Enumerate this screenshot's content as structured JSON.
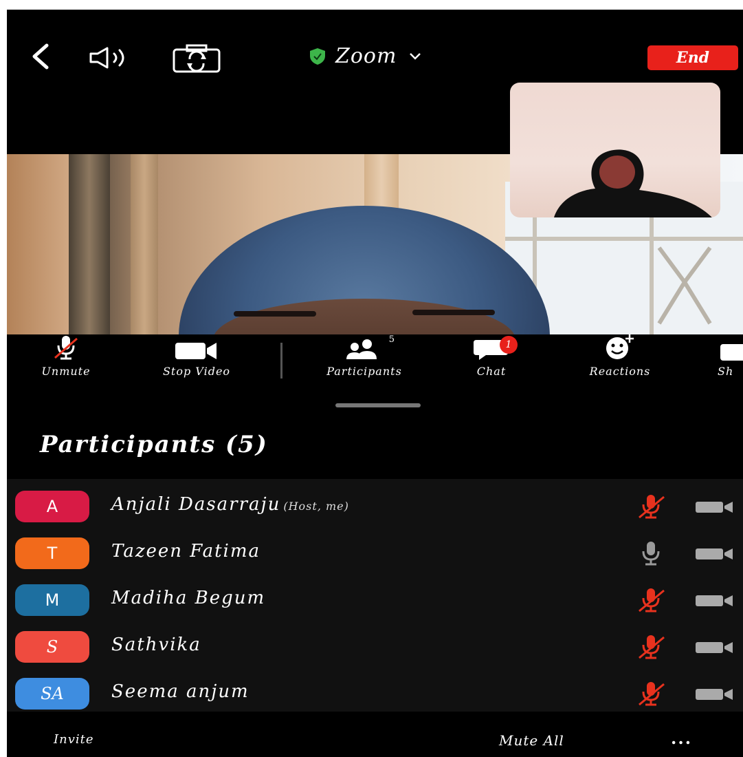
{
  "header": {
    "title": "Zoom",
    "end_label": "End"
  },
  "toolbar": {
    "items": [
      {
        "label": "Unmute"
      },
      {
        "label": "Stop Video"
      },
      {
        "label": "Participants",
        "count": "5"
      },
      {
        "label": "Chat",
        "badge": "1"
      },
      {
        "label": "Reactions"
      },
      {
        "label": "Sh"
      }
    ]
  },
  "participants": {
    "title": "Participants (5)",
    "list": [
      {
        "initial": "A",
        "name": "Anjali Dasarraju",
        "role": "(Host, me)",
        "avatar_color": "#d81b45",
        "mic": "muted"
      },
      {
        "initial": "T",
        "name": "Tazeen Fatima",
        "role": "",
        "avatar_color": "#f26a1b",
        "mic": "on"
      },
      {
        "initial": "M",
        "name": "Madiha Begum",
        "role": "",
        "avatar_color": "#1d6fa0",
        "mic": "muted"
      },
      {
        "initial": "S",
        "name": "Sathvika",
        "role": "",
        "avatar_color": "#ef4b3f",
        "mic": "muted"
      },
      {
        "initial": "SA",
        "name": "Seema anjum",
        "role": "",
        "avatar_color": "#3e8de0",
        "mic": "muted"
      }
    ]
  },
  "footer": {
    "invite_label": "Invite",
    "mute_all_label": "Mute All",
    "more_label": "..."
  },
  "colors": {
    "end_button": "#e8211b",
    "muted_mic": "#e8321e",
    "shield": "#3db54a"
  }
}
